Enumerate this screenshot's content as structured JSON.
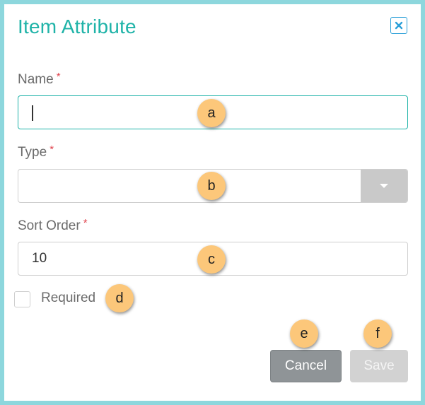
{
  "dialog": {
    "title": "Item Attribute",
    "close_icon": "close-icon"
  },
  "fields": {
    "name": {
      "label": "Name",
      "required_mark": "*",
      "value": ""
    },
    "type": {
      "label": "Type",
      "required_mark": "*",
      "value": "",
      "toggle_icon": "caret-down-icon"
    },
    "sort_order": {
      "label": "Sort Order",
      "required_mark": "*",
      "value": "10"
    }
  },
  "required_checkbox": {
    "label": "Required",
    "checked": false
  },
  "buttons": {
    "cancel": "Cancel",
    "save": "Save"
  },
  "markers": {
    "a": "a",
    "b": "b",
    "c": "c",
    "d": "d",
    "e": "e",
    "f": "f"
  },
  "colors": {
    "accent": "#1fb3a8",
    "frame": "#8dd7dd",
    "required": "#e0454f",
    "marker": "#fcc77a",
    "cancel_bg": "#8f9497",
    "save_bg_disabled": "#d2d2d2"
  }
}
